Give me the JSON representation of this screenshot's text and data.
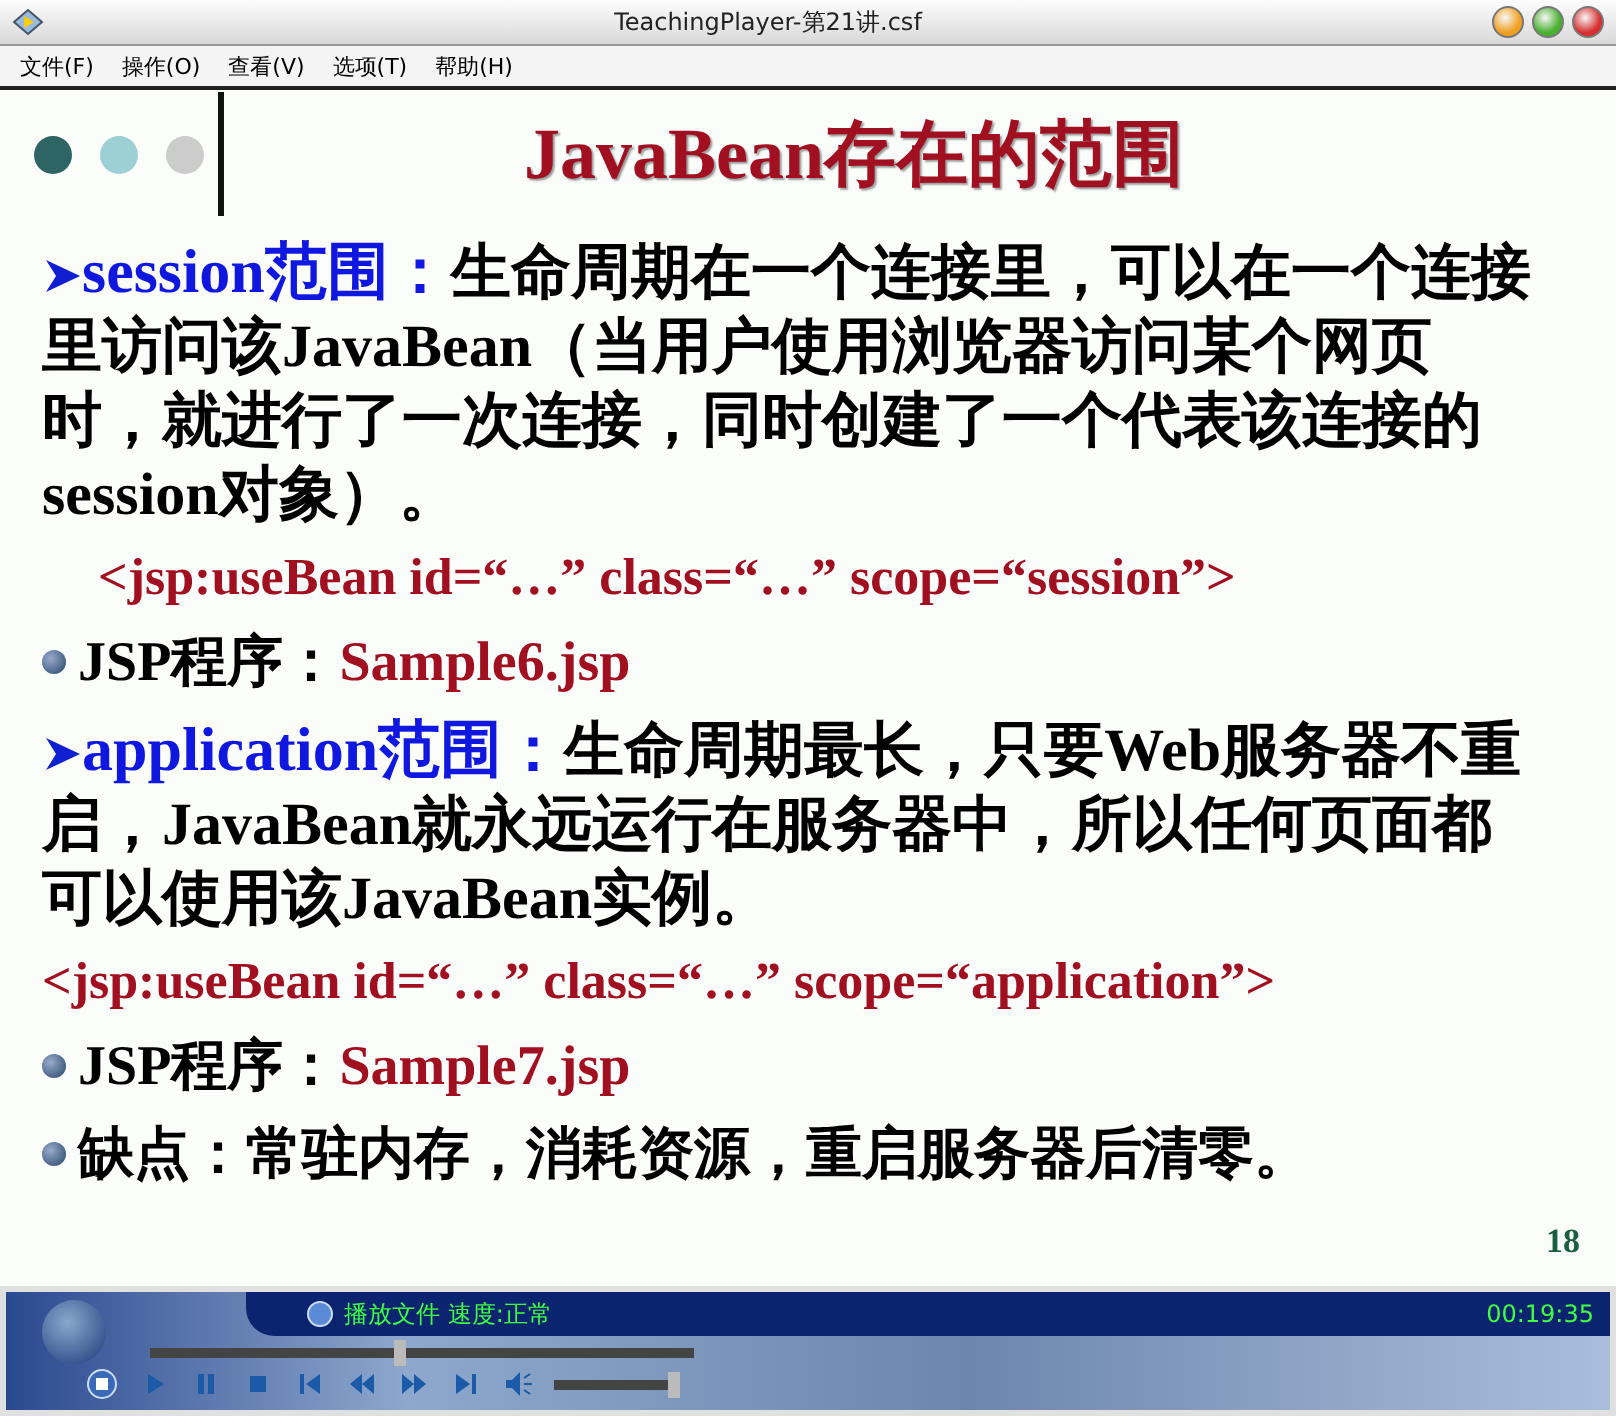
{
  "window": {
    "title": "TeachingPlayer-第21讲.csf"
  },
  "menu": [
    "文件(F)",
    "操作(O)",
    "查看(V)",
    "选项(T)",
    "帮助(H)"
  ],
  "slide": {
    "title": "JavaBean存在的范围",
    "page": "18",
    "blocks": [
      {
        "kind": "heading",
        "term": "session范围：",
        "text": "生命周期在一个连接里，可以在一个连接里访问该JavaBean（当用户使用浏览器访问某个网页时，就进行了一次连接，同时创建了一个代表该连接的session对象）。"
      },
      {
        "kind": "code",
        "indented": true,
        "text": "<jsp:useBean  id=“…”  class=“…”  scope=“session”>"
      },
      {
        "kind": "bullet",
        "label": "JSP程序：",
        "value": "Sample6.jsp"
      },
      {
        "kind": "heading",
        "term": "application范围：",
        "text": "生命周期最长，只要Web服务器不重启，JavaBean就永远运行在服务器中，所以任何页面都可以使用该JavaBean实例。"
      },
      {
        "kind": "code",
        "indented": false,
        "text": "<jsp:useBean  id=“…”  class=“…”  scope=“application”>"
      },
      {
        "kind": "bullet",
        "label": "JSP程序：",
        "value": "Sample7.jsp"
      },
      {
        "kind": "bullet",
        "label": "缺点：常驻内存，消耗资源，重启服务器后清零。"
      }
    ]
  },
  "player": {
    "status": "播放文件 速度:正常",
    "time": "00:19:35",
    "progress": {
      "level": 0.46
    },
    "volume": {
      "level": 1
    }
  }
}
